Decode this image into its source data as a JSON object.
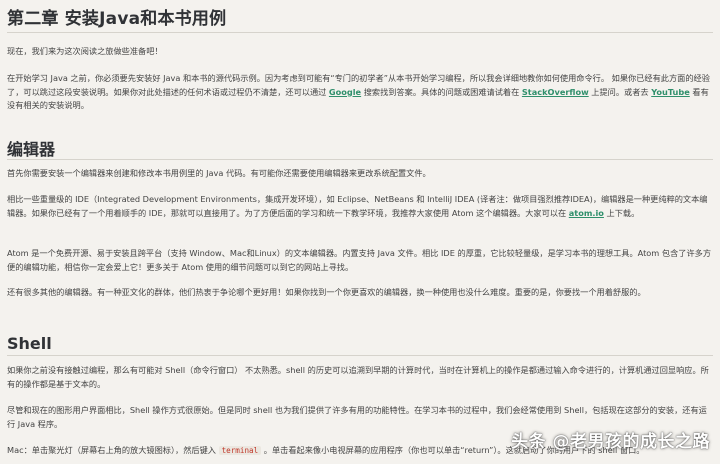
{
  "chapter_title": "第二章 安装Java和本书用例",
  "intro": "现在，我们来为这次阅读之旅做些准备吧！",
  "para2_a": "在开始学习 Java 之前，你必须要先安装好 Java 和本书的源代码示例。因为考虑到可能有“专门的初学者”从本书开始学习编程，所以我会详细地教你如何使用命令行。 如果你已经有此方面的经验了，可以跳过这段安装说明。如果你对此处描述的任何术语或过程仍不清楚，还可以通过 ",
  "link_google": "Google",
  "para2_b": " 搜索找到答案。具体的问题或困难请试着在 ",
  "link_stackoverflow": "StackOverflow",
  "para2_c": " 上提问。或者去 ",
  "link_youtube": "YouTube",
  "para2_d": " 看有没有相关的安装说明。",
  "editor_heading": "编辑器",
  "editor_p1": "首先你需要安装一个编辑器来创建和修改本书用例里的 Java 代码。有可能你还需要使用编辑器来更改系统配置文件。",
  "editor_p2_a": "相比一些重量级的 IDE（Integrated Development Environments，集成开发环境），如 Eclipse、NetBeans 和 IntelliJ IDEA (译者注：做项目强烈推荐IDEA)，编辑器是一种更纯粹的文本编辑器。如果你已经有了一个用着顺手的 IDE，那就可以直接用了。为了方便后面的学习和统一下教学环境，我推荐大家使用 Atom 这个编辑器。大家可以在 ",
  "link_atom": "atom.io",
  "editor_p2_b": " 上下载。",
  "editor_p3": "Atom 是一个免费开源、易于安装且跨平台（支持 Window、Mac和Linux）的文本编辑器。内置支持 Java 文件。相比 IDE 的厚重，它比较轻量级，是学习本书的理想工具。Atom 包含了许多方便的编辑功能，相信你一定会爱上它！更多关于 Atom 使用的细节问题可以到它的网站上寻找。",
  "editor_p4": "还有很多其他的编辑器。有一种亚文化的群体，他们热衷于争论哪个更好用！如果你找到一个你更喜欢的编辑器，换一种使用也没什么难度。重要的是，你要找一个用着舒服的。",
  "shell_heading": "Shell",
  "shell_p1": "如果你之前没有接触过编程，那么有可能对 Shell（命令行窗口） 不太熟悉。shell 的历史可以追溯到早期的计算时代，当时在计算机上的操作是都通过输入命令进行的，计算机通过回显响应。所有的操作都是基于文本的。",
  "shell_p2": "尽管和现在的图形用户界面相比，Shell 操作方式很原始。但是同时 shell 也为我们提供了许多有用的功能特性。在学习本书的过程中，我们会经常使用到 Shell，包括现在这部分的安装，还有运行 Java 程序。",
  "shell_p3_a": "Mac：单击聚光灯（屏幕右上角的放大镜图标），然后键入 ",
  "code_terminal": "terminal",
  "shell_p3_b": " 。单击看起来像小电视屏幕的应用程序（你也可以单击“return”）。这就启动了你的用户下的 shell 窗口。",
  "watermark": "头条 @老男孩的成长之路"
}
